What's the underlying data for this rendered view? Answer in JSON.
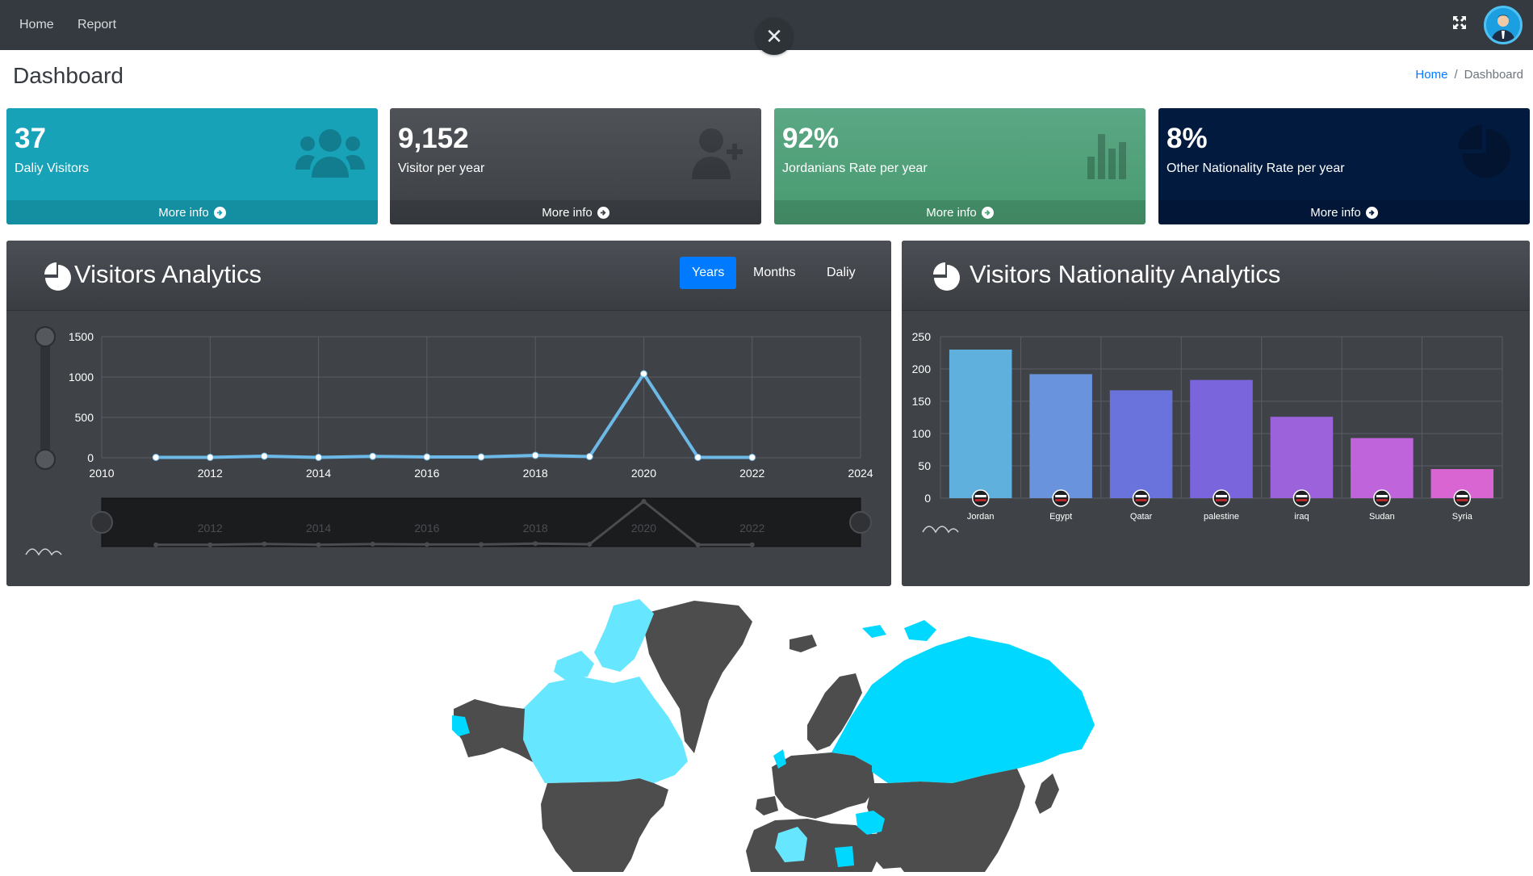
{
  "nav": {
    "home": "Home",
    "report": "Report"
  },
  "close_symbol": "✕",
  "page": {
    "title": "Dashboard"
  },
  "breadcrumb": {
    "home": "Home",
    "separator": "/",
    "current": "Dashboard"
  },
  "stats": [
    {
      "value": "37",
      "label": "Daliy Visitors",
      "more": "More info",
      "color": "#17a2b8",
      "icon": "users-icon"
    },
    {
      "value": "9,152",
      "label": "Visitor per year",
      "more": "More info",
      "color": "#3c4047",
      "icon": "user-plus-icon"
    },
    {
      "value": "92%",
      "label": "Jordanians Rate per year",
      "more": "More info",
      "color": "#4ba67a",
      "icon": "bar-chart-icon"
    },
    {
      "value": "8%",
      "label": "Other Nationality Rate per year",
      "more": "More info",
      "color": "#031a3f",
      "icon": "pie-chart-icon"
    }
  ],
  "visitors_panel": {
    "title": "Visitors Analytics",
    "tabs": [
      "Years",
      "Months",
      "Daliy"
    ],
    "active_tab": "Years"
  },
  "nationality_panel": {
    "title": "Visitors Nationality Analytics"
  },
  "chart_data": [
    {
      "type": "line",
      "x": [
        2011,
        2012,
        2013,
        2014,
        2015,
        2016,
        2017,
        2018,
        2019,
        2020,
        2021,
        2022
      ],
      "series": [
        {
          "values": [
            5,
            5,
            20,
            5,
            18,
            10,
            10,
            30,
            15,
            1040,
            5,
            5
          ]
        }
      ],
      "xlim": [
        2010,
        2024
      ],
      "ylim": [
        0,
        1500
      ],
      "xticks": [
        "2010",
        "2012",
        "2014",
        "2016",
        "2018",
        "2020",
        "2022",
        "2024"
      ],
      "yticks": [
        "0",
        "500",
        "1000",
        "1500"
      ],
      "navigator_labels": [
        "2012",
        "2014",
        "2016",
        "2018",
        "2020",
        "2022"
      ],
      "grid": true,
      "color": "#6cb8e6"
    },
    {
      "type": "bar",
      "categories": [
        "Jordan",
        "Egypt",
        "Qatar",
        "palestine",
        "iraq",
        "Sudan",
        "Syria"
      ],
      "values": [
        230,
        192,
        167,
        183,
        126,
        93,
        45
      ],
      "ylim": [
        0,
        250
      ],
      "yticks": [
        "0",
        "50",
        "100",
        "150",
        "200",
        "250"
      ],
      "grid": true,
      "colors": [
        "#5fb0dd",
        "#6a93dd",
        "#6a73dc",
        "#7b65dc",
        "#9b62dc",
        "#c064dc",
        "#d865d2"
      ]
    }
  ],
  "map": {
    "highlight_color": "#00d8ff",
    "light_color": "#67e6ff",
    "base_color": "#4d4d4d"
  }
}
